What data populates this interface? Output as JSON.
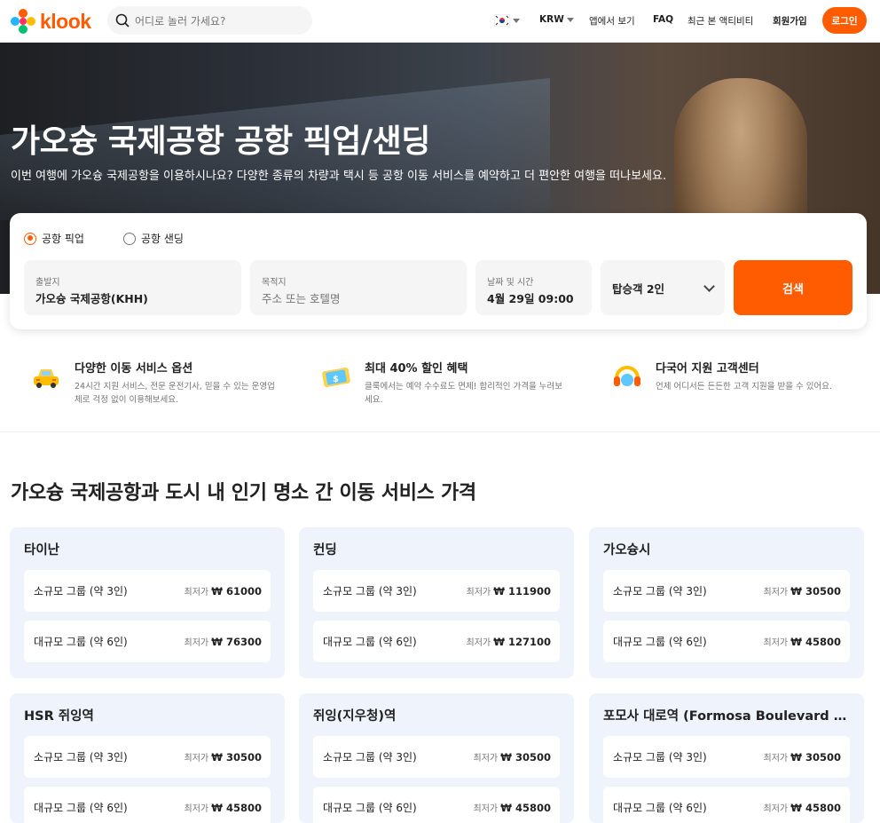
{
  "header": {
    "logo_text": "klook",
    "search_placeholder": "어디로 놀러 가세요?",
    "currency": "KRW",
    "nav_app": "앱에서 보기",
    "nav_faq": "FAQ",
    "nav_recent": "최근 본 액티비티",
    "nav_signup": "회원가입",
    "login": "로그인"
  },
  "hero": {
    "title": "가오슝 국제공항 공항 픽업/샌딩",
    "subtitle": "이번 여행에 가오슝 국제공항을 이용하시나요? 다양한 종류의 차량과 택시 등 공항 이동 서비스를 예약하고 더 편안한 여행을 떠나보세요."
  },
  "booking": {
    "options": [
      {
        "label": "공항 픽업",
        "selected": true
      },
      {
        "label": "공항 샌딩",
        "selected": false
      }
    ],
    "origin_label": "출발지",
    "origin_value": "가오슝 국제공항(KHH)",
    "dest_label": "목적지",
    "dest_placeholder": "주소 또는 호텔명",
    "datetime_label": "날짜 및 시간",
    "datetime_value": "4월 29일 09:00",
    "passengers": "탑승객 2인",
    "search": "검색"
  },
  "features": [
    {
      "icon": "car-icon",
      "title": "다양한 이동 서비스 옵션",
      "desc": "24시간 지원 서비스, 전문 운전기사, 믿을 수 있는 운영업체로 걱정 없이 이용해보세요."
    },
    {
      "icon": "ticket-discount-icon",
      "title": "최대 40% 할인 혜택",
      "desc": "클룩에서는 예약 수수료도 면제! 합리적인 가격을 누려보세요."
    },
    {
      "icon": "headset-icon",
      "title": "다국어 지원 고객센터",
      "desc": "언제 어디서든 든든한 고객 지원을 받을 수 있어요."
    }
  ],
  "section_title": "가오슝 국제공항과 도시 내 인기 명소 간 이동 서비스 가격",
  "price_prefix": "최저가",
  "destinations": [
    {
      "name": "타이난",
      "rows": [
        {
          "label": "소규모 그룹 (약 3인)",
          "price": "₩ 61000"
        },
        {
          "label": "대규모 그룹 (약 6인)",
          "price": "₩ 76300"
        }
      ]
    },
    {
      "name": "컨딩",
      "rows": [
        {
          "label": "소규모 그룹 (약 3인)",
          "price": "₩ 111900"
        },
        {
          "label": "대규모 그룹 (약 6인)",
          "price": "₩ 127100"
        }
      ]
    },
    {
      "name": "가오슝시",
      "rows": [
        {
          "label": "소규모 그룹 (약 3인)",
          "price": "₩ 30500"
        },
        {
          "label": "대규모 그룹 (약 6인)",
          "price": "₩ 45800"
        }
      ]
    },
    {
      "name": "HSR 쥐잉역",
      "rows": [
        {
          "label": "소규모 그룹 (약 3인)",
          "price": "₩ 30500"
        },
        {
          "label": "대규모 그룹 (약 6인)",
          "price": "₩ 45800"
        }
      ]
    },
    {
      "name": "쥐잉(지우청)역",
      "rows": [
        {
          "label": "소규모 그룹 (약 3인)",
          "price": "₩ 30500"
        },
        {
          "label": "대규모 그룹 (약 6인)",
          "price": "₩ 45800"
        }
      ]
    },
    {
      "name": "포모사 대로역 (Formosa Boulevard Sta...",
      "rows": [
        {
          "label": "소규모 그룹 (약 3인)",
          "price": "₩ 30500"
        },
        {
          "label": "대규모 그룹 (약 6인)",
          "price": "₩ 45800"
        }
      ]
    }
  ],
  "colors": {
    "brand": "#ff5b00",
    "card_bg": "#eef3fc"
  }
}
